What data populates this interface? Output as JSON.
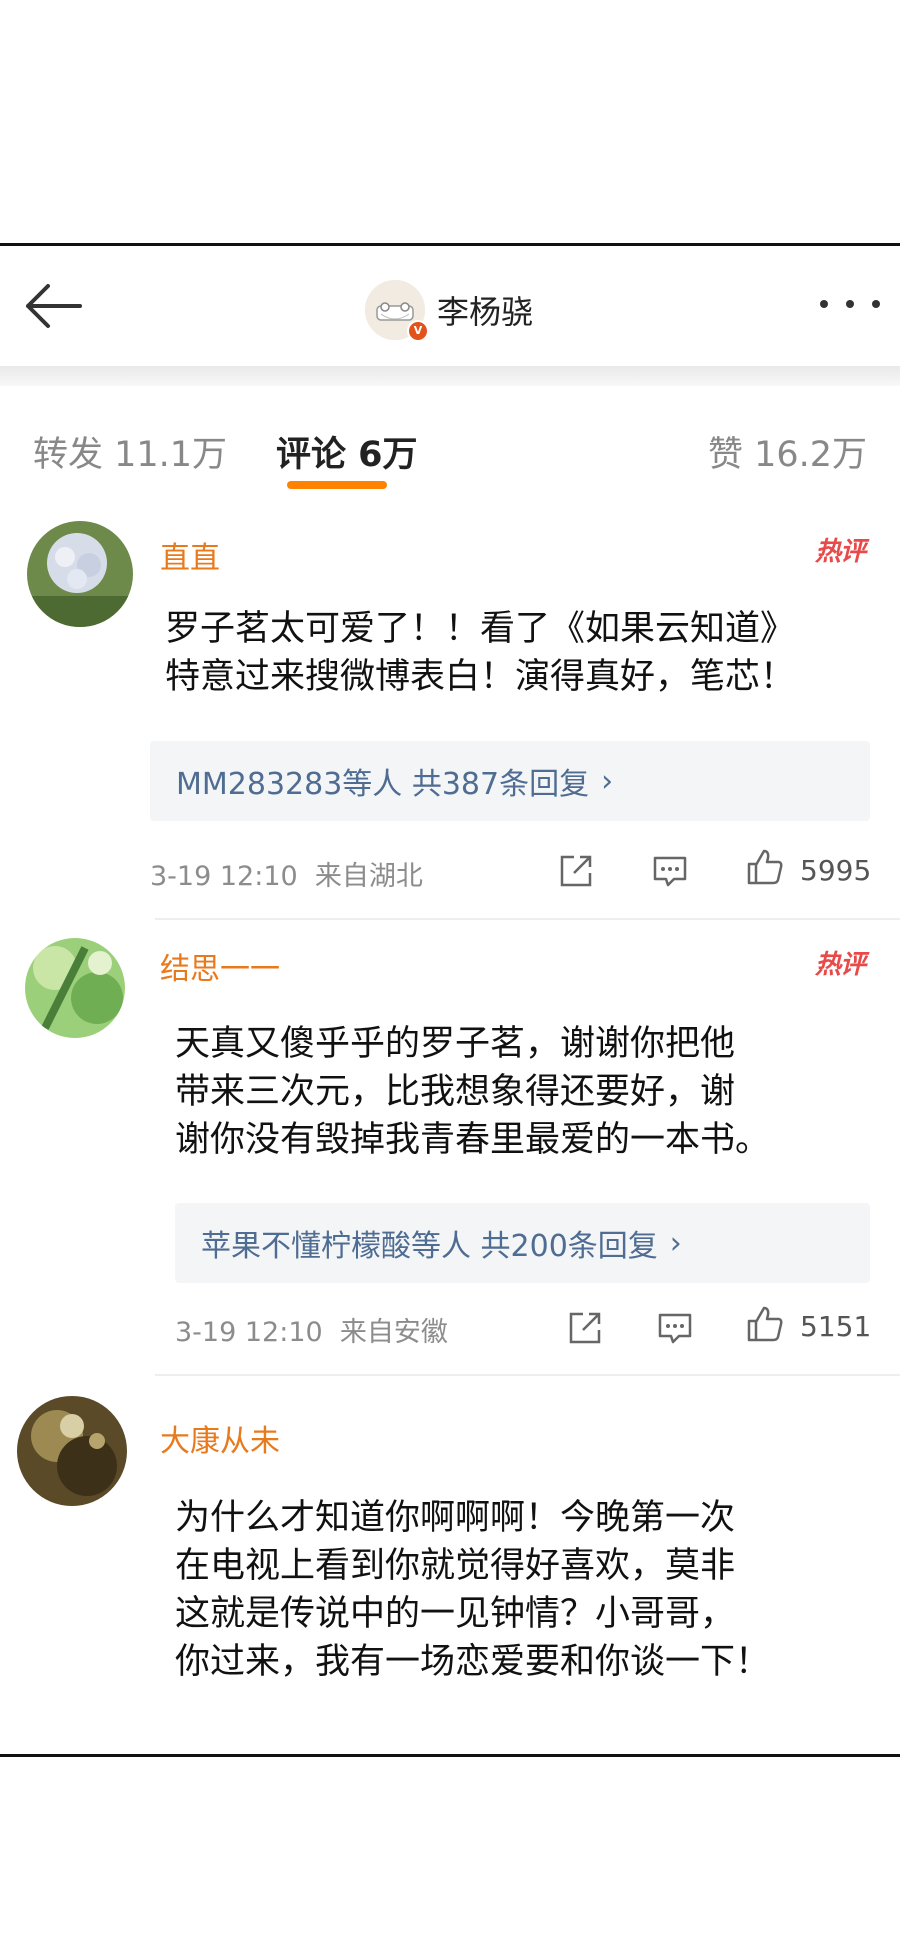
{
  "header": {
    "title": "李杨骁",
    "verified_badge": "V"
  },
  "tabs": [
    {
      "label": "转发 11.1万"
    },
    {
      "label": "评论 6万"
    },
    {
      "label": "赞 16.2万"
    }
  ],
  "accent_color": "#ff8200",
  "comments": [
    {
      "name": "直直",
      "badge": "热评",
      "text": "罗子茗太可爱了！！看了《如果云知道》\n特意过来搜微博表白！演得真好，笔芯！",
      "reply": "MM283283等人  共387条回复",
      "time": "3-19 12:10",
      "location": "来自湖北",
      "likes": "5995"
    },
    {
      "name": "结思一一",
      "badge": "热评",
      "text": "天真又傻乎乎的罗子茗，谢谢你把他\n带来三次元，比我想象得还要好，谢\n谢你没有毁掉我青春里最爱的一本书。",
      "reply": "苹果不懂柠檬酸等人  共200条回复",
      "time": "3-19 12:10",
      "location": "来自安徽",
      "likes": "5151"
    },
    {
      "name": "大康从未",
      "text": "为什么才知道你啊啊啊！今晚第一次\n在电视上看到你就觉得好喜欢，莫非\n这就是传说中的一见钟情？小哥哥，\n你过来，我有一场恋爱要和你谈一下！"
    }
  ]
}
